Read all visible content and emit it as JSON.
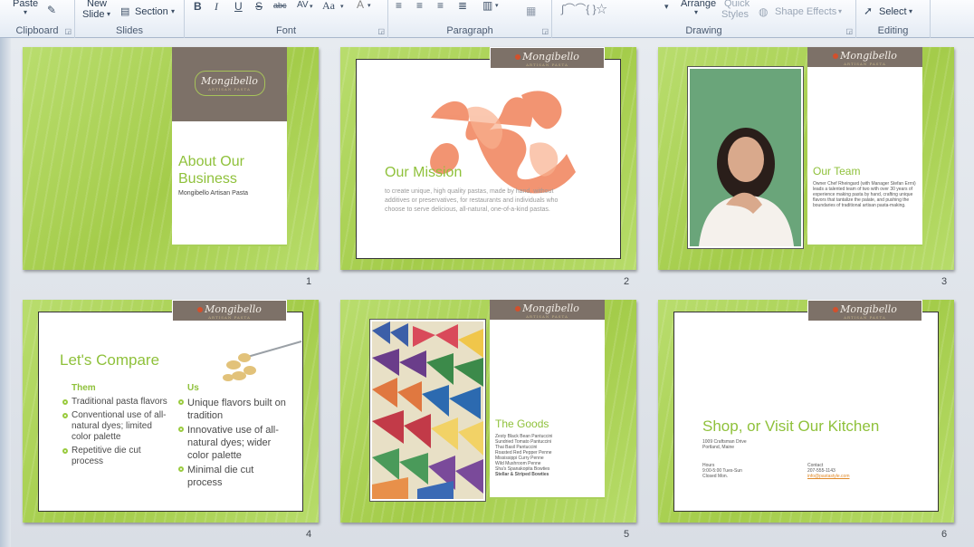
{
  "ribbon": {
    "clipboard": {
      "paste": "Paste",
      "label": "Clipboard"
    },
    "slides": {
      "new_slide_line1": "New",
      "new_slide_line2": "Slide",
      "section": "Section",
      "label": "Slides"
    },
    "font": {
      "label": "Font",
      "change_case": "Aa"
    },
    "paragraph": {
      "label": "Paragraph"
    },
    "drawing": {
      "arrange": "Arrange",
      "quick_styles_1": "Quick",
      "quick_styles_2": "Styles",
      "shape_effects": "Shape Effects",
      "label": "Drawing"
    },
    "editing": {
      "select": "Select",
      "label": "Editing"
    }
  },
  "brand": {
    "name": "Mongibello",
    "tag": "ARTISAN PASTA"
  },
  "slides": [
    {
      "number": "1",
      "title_line1": "About Our",
      "title_line2": "Business",
      "subtitle": "Mongibello Artisan Pasta"
    },
    {
      "number": "2",
      "title": "Our Mission",
      "body": "to create unique, high quality pastas, made by hand, without additives or preservatives, for restaurants and individuals who choose to serve delicious, all-natural, one-of-a-kind pastas."
    },
    {
      "number": "3",
      "title": "Our Team",
      "body": "Owner Chef Rheingard (with Manager Stefan Errni) leads a talented team of two with over 30 years of experience making pasta by hand, crafting unique flavors that tantalize the palate, and pushing the boundaries of traditional artisan pasta-making."
    },
    {
      "number": "4",
      "title": "Let's Compare",
      "col1_head": "Them",
      "col2_head": "Us",
      "col1": [
        "Traditional pasta flavors",
        "Conventional use of all-natural dyes; limited color palette",
        "Repetitive die cut process"
      ],
      "col2": [
        "Unique flavors built on tradition",
        "Innovative use of all-natural dyes; wider color palette",
        "Minimal die cut process"
      ]
    },
    {
      "number": "5",
      "title": "The Goods",
      "items": [
        "Zesty Black Bean Pantuccini",
        "Sundried Tomato Pantuccini",
        "Thai Basil Pantuccini",
        "Roasted Red Pepper Penne",
        "Mississippi Curry Penne",
        "Wild Mushroom Penne",
        "Sha's Spanakopita Bowties",
        "Stellar & Striped Bowties"
      ]
    },
    {
      "number": "6",
      "title": "Shop, or Visit Our Kitchen",
      "addr1": "1009 Craftsman Drive",
      "addr2": "Portland, Maine",
      "hours_head": "Hours",
      "hours1": "9:00-5:00 Tues-Sun",
      "hours2": "Closed Mon.",
      "contact_head": "Contact",
      "phone": "207-555-1143",
      "email": "info@pastastyle.com"
    }
  ],
  "colors": {
    "slide_green": "#a4cc4a",
    "title_green": "#8fc13b",
    "logo_brown": "#7d7168"
  }
}
